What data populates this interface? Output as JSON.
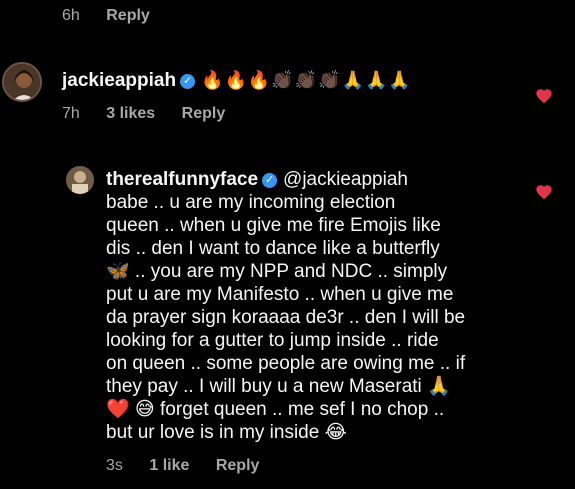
{
  "top_meta": {
    "time": "6h",
    "reply": "Reply"
  },
  "comment1": {
    "username": "jackieappiah",
    "emoji_text": "🔥🔥🔥👏🏿👏🏿👏🏿🙏🙏🙏",
    "time": "7h",
    "likes": "3 likes",
    "reply": "Reply"
  },
  "comment2": {
    "username": "therealfunnyface",
    "mention": "@jackieappiah",
    "lines": [
      "babe ..  u are my incoming election",
      "queen .. when u give me fire Emojis like",
      "dis .. den I want to dance like a butterfly",
      "🦋 .. you are my NPP and NDC ..  simply",
      "put u are my Manifesto .. when u give me",
      "da prayer sign koraaaa de3r .. den I will be",
      "looking for a gutter to jump inside .. ride",
      "on queen .. some people are owing me .. if",
      "they pay .. I will buy u a new Maserati 🙏",
      "❤️ 😅 forget queen .. me sef I no chop ..",
      "but ur love is in my inside 😂"
    ],
    "time": "3s",
    "likes": "1 like",
    "reply": "Reply"
  },
  "colors": {
    "heart": "#e0364c",
    "verified": "#3897f0",
    "meta": "#a8a8a8"
  },
  "icons": {
    "like": "heart-icon",
    "verified": "verified-badge-icon"
  }
}
